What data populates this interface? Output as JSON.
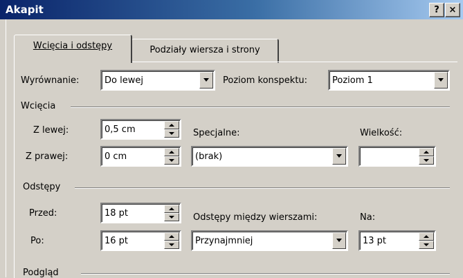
{
  "window": {
    "title": "Akapit",
    "help_label": "?",
    "close_label": "×"
  },
  "tabs": [
    {
      "label": "Wcięcia i odstępy",
      "active": true
    },
    {
      "label": "Podziały wiersza i strony",
      "active": false
    }
  ],
  "general": {
    "alignment_label": "Wyrównanie:",
    "alignment_value": "Do lewej",
    "outline_label": "Poziom konspektu:",
    "outline_value": "Poziom 1"
  },
  "indents": {
    "group_label": "Wcięcia",
    "left_label": "Z lewej:",
    "left_value": "0,5 cm",
    "right_label": "Z prawej:",
    "right_value": "0 cm",
    "special_label": "Specjalne:",
    "special_value": "(brak)",
    "size_label": "Wielkość:",
    "size_value": ""
  },
  "spacing": {
    "group_label": "Odstępy",
    "before_label": "Przed:",
    "before_value": "18 pt",
    "after_label": "Po:",
    "after_value": "16 pt",
    "line_label": "Odstępy między wierszami:",
    "line_value": "Przynajmniej",
    "at_label": "Na:",
    "at_value": "13 pt"
  },
  "preview": {
    "group_label": "Podgląd"
  }
}
